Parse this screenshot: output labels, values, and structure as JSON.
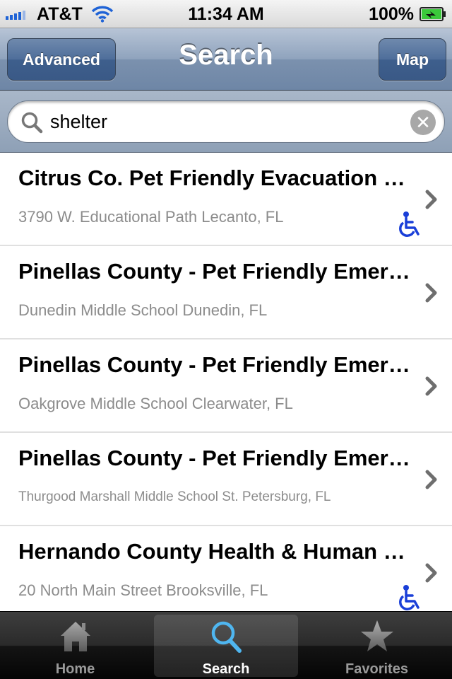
{
  "status_bar": {
    "carrier": "AT&T",
    "time": "11:34 AM",
    "battery": "100%"
  },
  "nav": {
    "title": "Search",
    "left_button": "Advanced",
    "right_button": "Map"
  },
  "search": {
    "value": "shelter"
  },
  "results": [
    {
      "title": "Citrus Co. Pet Friendly Evacuation Shelter",
      "subtitle": "3790 W. Educational Path Lecanto, FL",
      "wheelchair": true
    },
    {
      "title": "Pinellas County - Pet Friendly Emergency Shelter",
      "subtitle": "Dunedin Middle School Dunedin, FL",
      "wheelchair": false
    },
    {
      "title": "Pinellas County - Pet Friendly Emergency Shelter",
      "subtitle": "Oakgrove Middle School Clearwater, FL",
      "wheelchair": false
    },
    {
      "title": "Pinellas County - Pet Friendly Emergency Shelter",
      "subtitle": "Thurgood Marshall Middle School St. Petersburg, FL",
      "wheelchair": false
    },
    {
      "title": "Hernando County Health & Human Services",
      "subtitle": "20 North Main Street Brooksville, FL",
      "wheelchair": true
    }
  ],
  "tabs": [
    {
      "label": "Home",
      "icon": "house-icon",
      "active": false
    },
    {
      "label": "Search",
      "icon": "magnifier-icon",
      "active": true
    },
    {
      "label": "Favorites",
      "icon": "star-icon",
      "active": false
    }
  ],
  "colors": {
    "accent_blue": "#1f63d6",
    "wheelchair_blue": "#1a3fd8",
    "subtitle_gray": "#8c8c8c"
  }
}
